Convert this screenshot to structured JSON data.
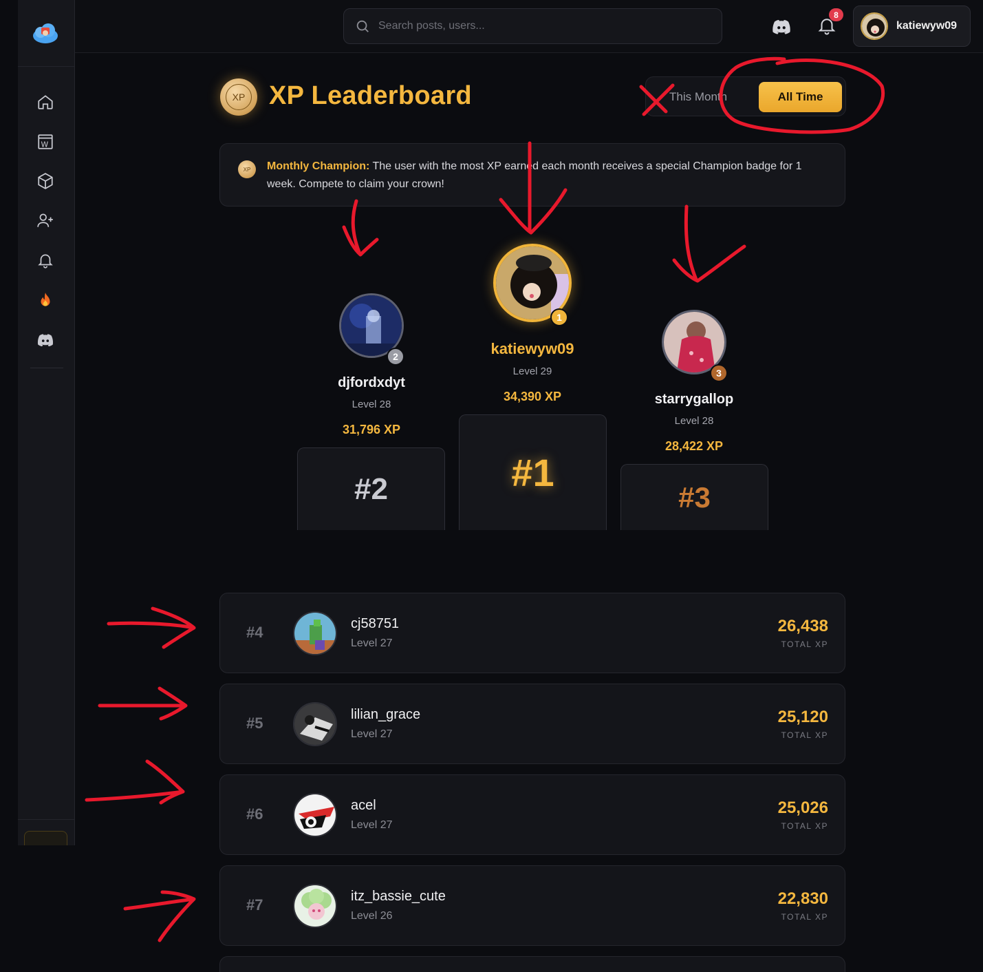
{
  "header": {
    "search_placeholder": "Search posts, users...",
    "notification_count": "8",
    "username": "katiewyw09"
  },
  "sidebar": {
    "items": [
      "home-icon",
      "wiki-icon",
      "cube-icon",
      "add-user-icon",
      "bell-icon",
      "fire-icon",
      "discord-icon"
    ]
  },
  "page": {
    "title": "XP Leaderboard",
    "coin_label": "XP",
    "toggle_month": "This Month",
    "toggle_all": "All Time"
  },
  "banner": {
    "coin_label": "XP",
    "lead": "Monthly Champion:",
    "text": " The user with the most XP earned each month receives a special Champion badge for 1 week. Compete to claim your crown!"
  },
  "podium": {
    "first": {
      "name": "katiewyw09",
      "level": "Level 29",
      "xp": "34,390 XP",
      "rank": "#1",
      "medal": "1"
    },
    "second": {
      "name": "djfordxdyt",
      "level": "Level 28",
      "xp": "31,796 XP",
      "rank": "#2",
      "medal": "2"
    },
    "third": {
      "name": "starrygallop",
      "level": "Level 28",
      "xp": "28,422 XP",
      "rank": "#3",
      "medal": "3"
    }
  },
  "list": [
    {
      "rank": "#4",
      "name": "cj58751",
      "level": "Level 27",
      "xp": "26,438",
      "xp_label": "TOTAL XP"
    },
    {
      "rank": "#5",
      "name": "lilian_grace",
      "level": "Level 27",
      "xp": "25,120",
      "xp_label": "TOTAL XP"
    },
    {
      "rank": "#6",
      "name": "acel",
      "level": "Level 27",
      "xp": "25,026",
      "xp_label": "TOTAL XP"
    },
    {
      "rank": "#7",
      "name": "itz_bassie_cute",
      "level": "Level 26",
      "xp": "22,830",
      "xp_label": "TOTAL XP"
    }
  ],
  "colors": {
    "accent_gold": "#f4b73f",
    "annotation_red": "#e8192c",
    "background": "#0b0c10"
  }
}
